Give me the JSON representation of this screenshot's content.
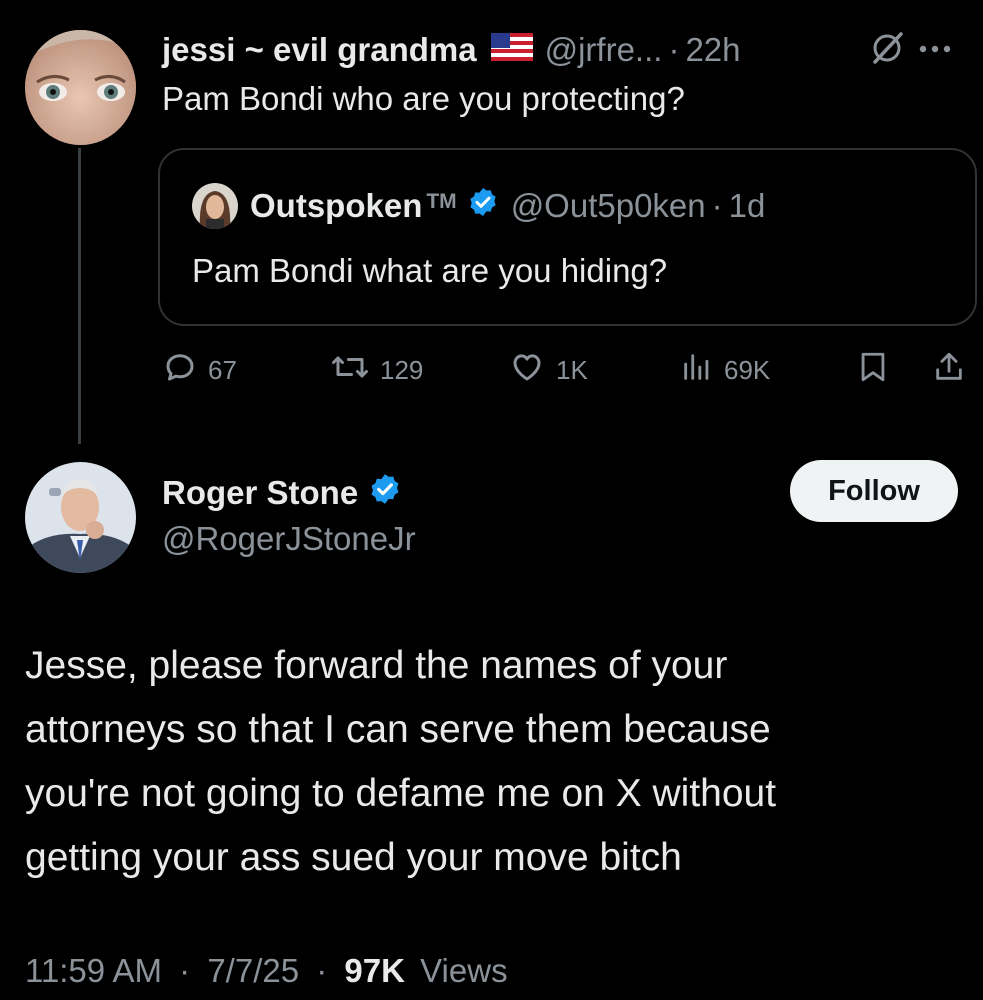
{
  "reply_tweet": {
    "author_name": "jessi ~ evil grandma",
    "flag_icon": "us-flag-icon",
    "handle": "@jrfre...",
    "separator": "·",
    "time": "22h",
    "text": "Pam Bondi who are you protecting?"
  },
  "quoted_tweet": {
    "author_name": "Outspoken",
    "trademark": "TM",
    "verified": true,
    "handle": "@Out5p0ken",
    "separator": "·",
    "time": "1d",
    "text": "Pam Bondi what are you hiding?"
  },
  "actions": {
    "replies": "67",
    "reposts": "129",
    "likes": "1K",
    "views": "69K"
  },
  "main_tweet": {
    "author_name": "Roger Stone",
    "verified": true,
    "handle": "@RogerJStoneJr",
    "follow_label": "Follow",
    "text_lines": [
      "Jesse, please forward the names of your",
      "attorneys so that I can serve them because",
      "you're not going to defame me on X without",
      "getting your ass sued your move bitch"
    ],
    "time": "11:59 AM",
    "date": "7/7/25",
    "separator": "·",
    "view_count": "97K",
    "view_label": "Views"
  },
  "colors": {
    "background": "#000000",
    "text": "#e7e9ea",
    "muted": "#8b9299",
    "verified": "#1d9bf0",
    "border": "#2f3336"
  }
}
